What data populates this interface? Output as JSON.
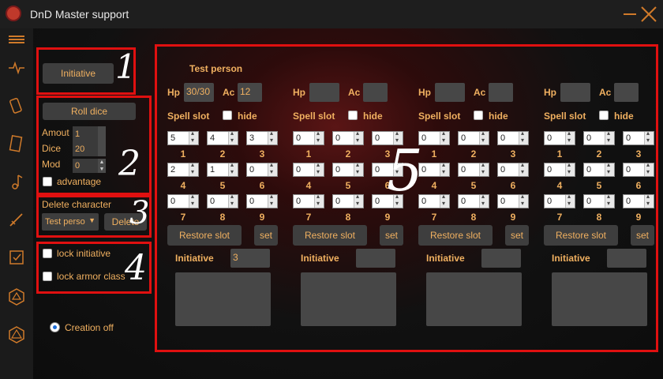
{
  "title": "DnD Master support",
  "sidebar_icons": [
    "hamburger-icon",
    "pulse-icon",
    "dice-icon",
    "scroll-icon",
    "music-note-icon",
    "sword-icon",
    "checklist-icon",
    "d20-icon",
    "d20-alt-icon"
  ],
  "box1": {
    "initiative_btn": "Initiative",
    "annotation": "1"
  },
  "box2": {
    "roll_btn": "Roll dice",
    "amount_label": "Amout",
    "amount_value": "1",
    "dice_label": "Dice",
    "dice_value": "20",
    "mod_label": "Mod",
    "mod_value": "0",
    "advantage_label": "advantage",
    "annotation": "2"
  },
  "box3": {
    "delete_label": "Delete character",
    "select_value": "Test perso",
    "delete_btn": "Delete",
    "annotation": "3"
  },
  "box4": {
    "lock_initiative": "lock initiative",
    "lock_armor": "lock armor class",
    "annotation": "4"
  },
  "creation": {
    "label": "Creation off"
  },
  "box5_annotation": "5",
  "card_labels": {
    "hp": "Hp",
    "ac": "Ac",
    "spell_slot": "Spell slot",
    "hide": "hide",
    "restore": "Restore slot",
    "set": "set",
    "initiative": "Initiative"
  },
  "slot_numbers": [
    "1",
    "2",
    "3",
    "4",
    "5",
    "6",
    "7",
    "8",
    "9"
  ],
  "cards": [
    {
      "name": "Test person",
      "hp": "30/30",
      "ac": "12",
      "slots": [
        "5",
        "4",
        "3",
        "2",
        "1",
        "0",
        "0",
        "0",
        "0"
      ],
      "initiative": "3"
    },
    {
      "name": "",
      "hp": "",
      "ac": "",
      "slots": [
        "0",
        "0",
        "0",
        "0",
        "0",
        "0",
        "0",
        "0",
        "0"
      ],
      "initiative": ""
    },
    {
      "name": "",
      "hp": "",
      "ac": "",
      "slots": [
        "0",
        "0",
        "0",
        "0",
        "0",
        "0",
        "0",
        "0",
        "0"
      ],
      "initiative": ""
    },
    {
      "name": "",
      "hp": "",
      "ac": "",
      "slots": [
        "0",
        "0",
        "0",
        "0",
        "0",
        "0",
        "0",
        "0",
        "0"
      ],
      "initiative": ""
    }
  ]
}
